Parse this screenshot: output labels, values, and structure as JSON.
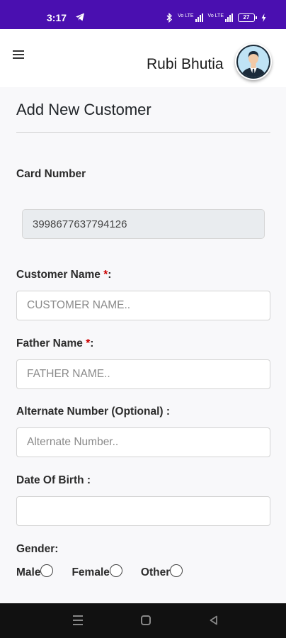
{
  "status_bar": {
    "time": "3:17",
    "battery": "27",
    "signal_label_1": "Vo LTE",
    "signal_label_2": "Vo LTE"
  },
  "header": {
    "user_name": "Rubi Bhutia"
  },
  "form": {
    "title": "Add New Customer",
    "card_number_label": "Card Number",
    "card_number_value": "3998677637794126",
    "customer_name_label": "Customer Name ",
    "customer_name_placeholder": "CUSTOMER NAME..",
    "father_name_label": "Father Name ",
    "father_name_placeholder": "FATHER NAME..",
    "required_mark": "*",
    "required_colon": ":",
    "alt_number_label": "Alternate Number (Optional) :",
    "alt_number_placeholder": "Alternate Number..",
    "dob_label": "Date Of Birth :",
    "dob_value": "",
    "gender_label": "Gender:",
    "gender_options": [
      "Male",
      "Female",
      "Other"
    ]
  },
  "colors": {
    "status_bar": "#4a0fb0",
    "required": "#cc0000",
    "nav_bar": "#111111"
  }
}
